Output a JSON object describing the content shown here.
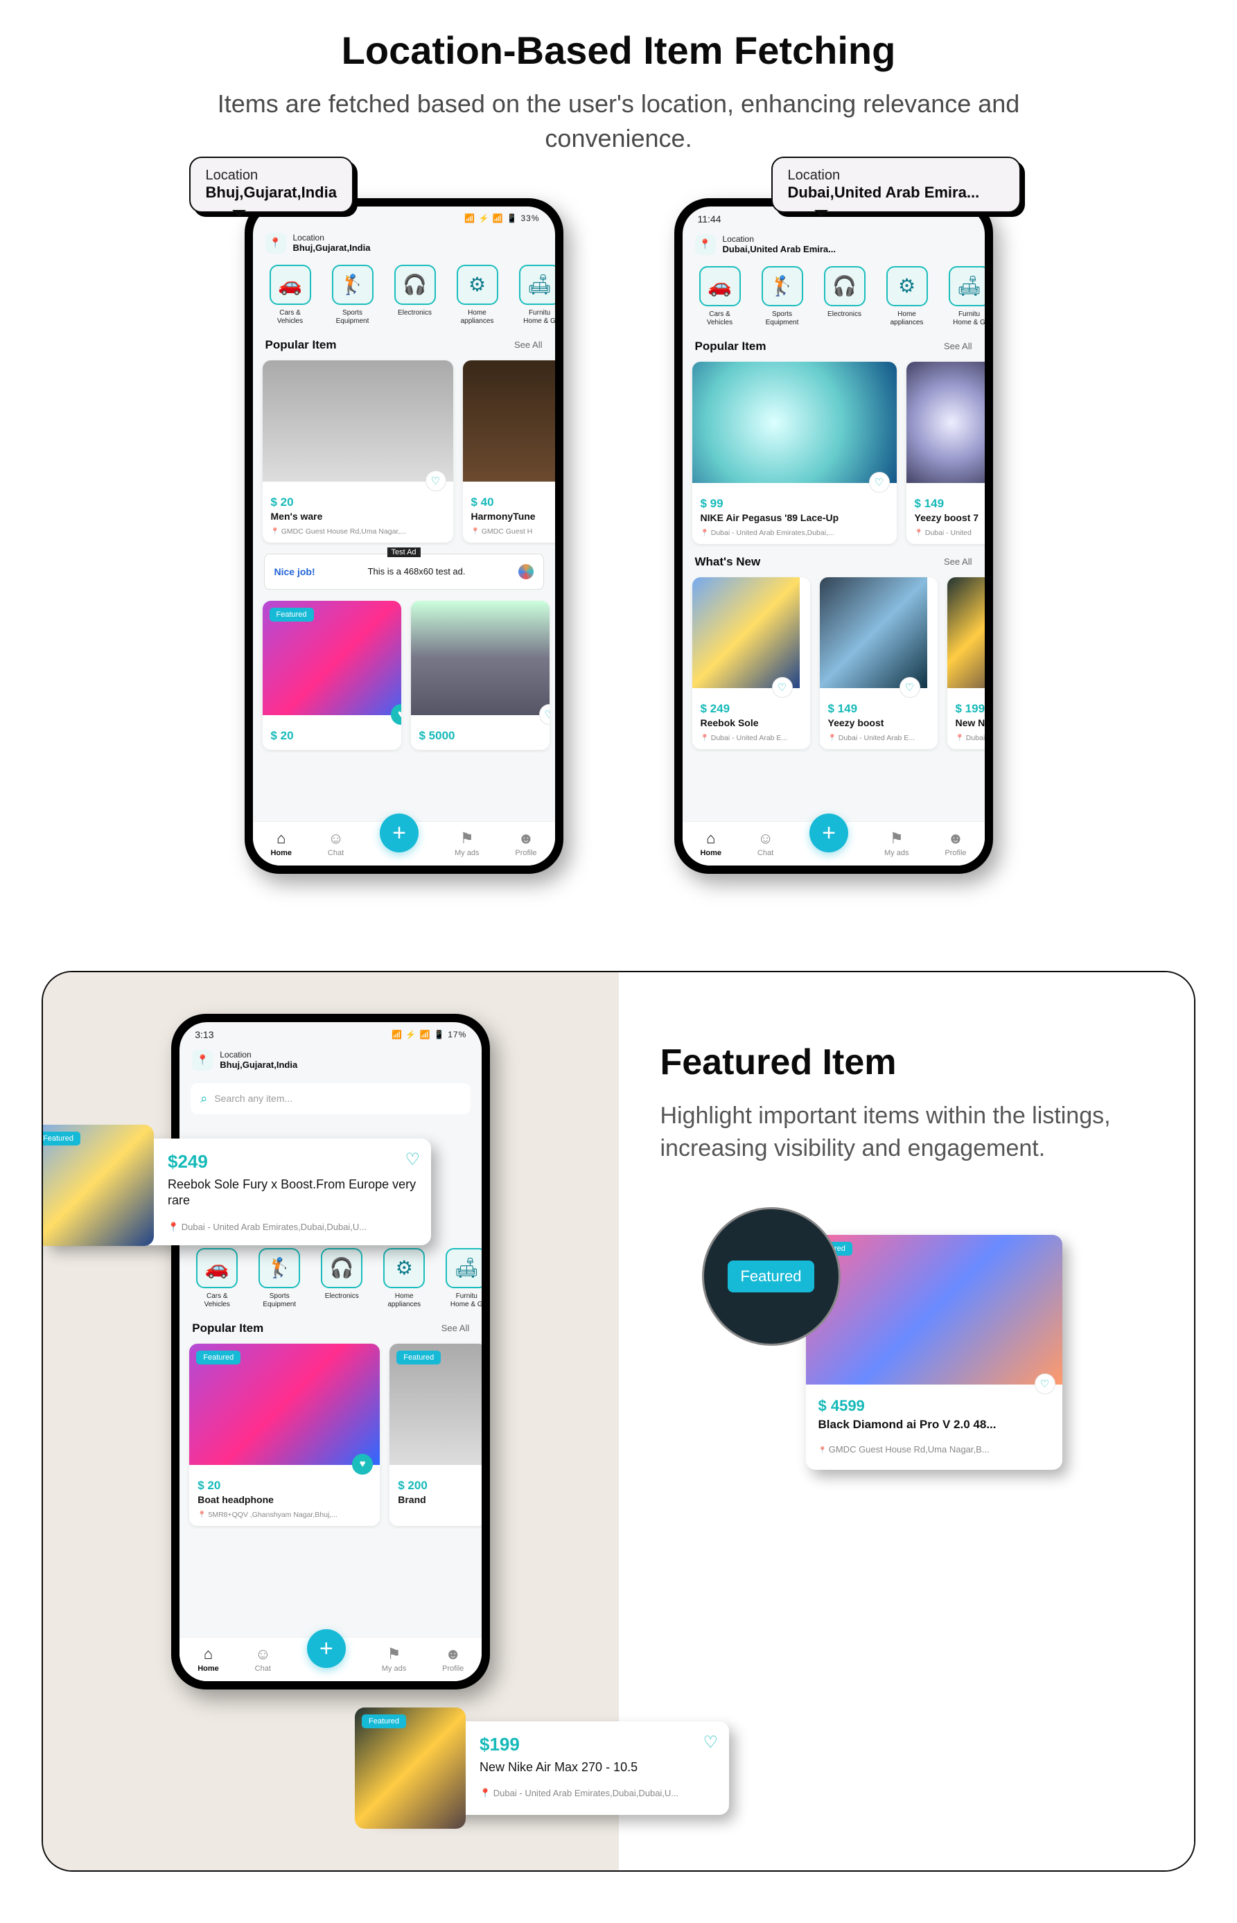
{
  "section1": {
    "title": "Location-Based Item Fetching",
    "subtitle": "Items are fetched based on the user's location, enhancing relevance and convenience."
  },
  "callout1": {
    "label": "Location",
    "value": "Bhuj,Gujarat,India"
  },
  "callout2": {
    "label": "Location",
    "value": "Dubai,United Arab Emira..."
  },
  "phone1": {
    "status": {
      "right": "📶 ⚡ 📶 📱 33%"
    },
    "loc": {
      "label": "Location",
      "value": "Bhuj,Gujarat,India"
    },
    "cats": [
      {
        "icon": "🚗",
        "name": "Cars &\nVehicles"
      },
      {
        "icon": "🏌",
        "name": "Sports\nEquipment"
      },
      {
        "icon": "🎧",
        "name": "Electronics"
      },
      {
        "icon": "⚙",
        "name": "Home\nappliances"
      },
      {
        "icon": "🛋",
        "name": "Furnitu\nHome & G"
      }
    ],
    "popular": {
      "title": "Popular Item",
      "see": "See All"
    },
    "pop_items": [
      {
        "price": "$ 20",
        "title": "Men's ware",
        "loc": "GMDC Guest House Rd,Uma Nagar,..."
      },
      {
        "price": "$ 40",
        "title": "HarmonyTune",
        "loc": "GMDC Guest H"
      }
    ],
    "ad": {
      "nice": "Nice job!",
      "label": "Test Ad",
      "text": "This is a 468x60 test ad."
    },
    "grid": [
      {
        "price": "$ 20",
        "featured": "Featured"
      },
      {
        "price": "$ 5000"
      }
    ]
  },
  "phone2": {
    "status": {
      "time": "11:44"
    },
    "loc": {
      "label": "Location",
      "value": "Dubai,United Arab Emira..."
    },
    "popular": {
      "title": "Popular Item",
      "see": "See All"
    },
    "pop_items": [
      {
        "price": "$ 99",
        "title": "NIKE Air Pegasus '89 Lace-Up",
        "loc": "Dubai - United Arab Emirates,Dubai,..."
      },
      {
        "price": "$ 149",
        "title": "Yeezy boost 7",
        "loc": "Dubai - United"
      }
    ],
    "new": {
      "title": "What's New",
      "see": "See All"
    },
    "new_items": [
      {
        "price": "$ 249",
        "title": "Reebok Sole",
        "loc": "Dubai - United Arab E..."
      },
      {
        "price": "$ 149",
        "title": "Yeezy boost",
        "loc": "Dubai - United Arab E..."
      },
      {
        "price": "$ 199",
        "title": "New Nik",
        "loc": "Dubai - U"
      }
    ]
  },
  "nav": {
    "home": "Home",
    "chat": "Chat",
    "myads": "My ads",
    "profile": "Profile"
  },
  "section2": {
    "title": "Featured Item",
    "subtitle": "Highlight important items within the listings, increasing visibility and engagement."
  },
  "phone3": {
    "status": {
      "time": "3:13",
      "right": "📶 ⚡ 📶 📱 17%"
    },
    "loc": {
      "label": "Location",
      "value": "Bhuj,Gujarat,India"
    },
    "search": {
      "placeholder": "Search any item..."
    },
    "popular": {
      "title": "Popular Item",
      "see": "See All"
    },
    "items": [
      {
        "price": "$ 20",
        "title": "Boat headphone",
        "loc": "5MR8+QQV ,Ghanshyam Nagar,Bhuj,...",
        "featured": "Featured"
      },
      {
        "price": "$ 200",
        "title": "Brand",
        "featured": "Featured"
      }
    ]
  },
  "popout1": {
    "featured": "Featured",
    "price": "$249",
    "title": "Reebok Sole Fury x Boost.From Europe very rare",
    "loc": "📍 Dubai - United Arab Emirates,Dubai,Dubai,U..."
  },
  "popout2": {
    "featured": "Featured",
    "price": "$199",
    "title": "New Nike Air Max 270 - 10.5",
    "loc": "📍 Dubai - United Arab Emirates,Dubai,Dubai,U..."
  },
  "zoom": {
    "tag": "Featured",
    "card": {
      "featured": "eatured",
      "price": "$ 4599",
      "title": "Black Diamond ai Pro V 2.0 48...",
      "loc": "GMDC Guest House Rd,Uma Nagar,B..."
    }
  }
}
